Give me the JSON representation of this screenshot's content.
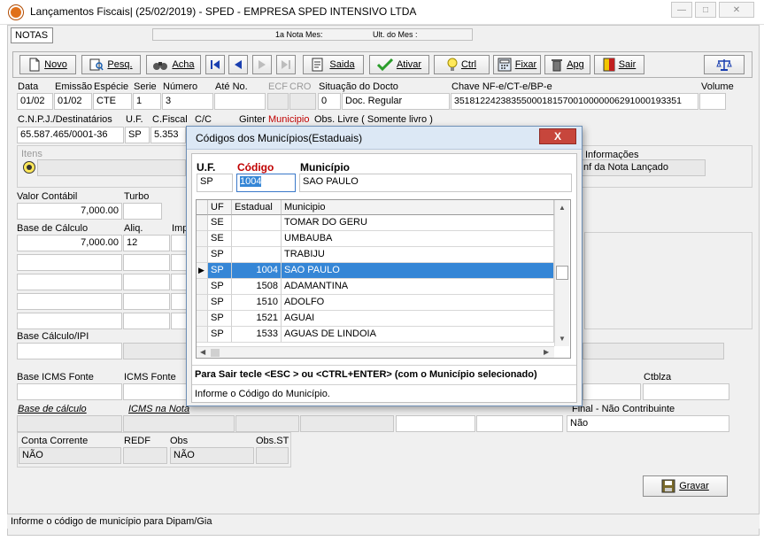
{
  "window": {
    "title": "Lançamentos Fiscais| (25/02/2019) - SPED - EMPRESA SPED INTENSIVO LTDA"
  },
  "header": {
    "tab_label": "NOTAS",
    "nota_mes_label": "1a Nota Mes:",
    "ult_mes_label": "Ult. do Mes :"
  },
  "toolbar": {
    "novo": "Novo",
    "pesq": "Pesq.",
    "acha": "Acha",
    "saida": "Saida",
    "ativar": "Ativar",
    "ctl": "Ctrl",
    "fixar": "Fixar",
    "apg": "Apg",
    "sair": "Sair"
  },
  "doc": {
    "labels": {
      "data": "Data",
      "emissao": "Emissão",
      "especie": "Espécie",
      "serie": "Serie",
      "numero": "Número",
      "ate_no": "Até No.",
      "ecf": "ECF",
      "cro": "CRO",
      "situacao": "Situação do Docto",
      "chave": "Chave NF-e/CT-e/BP-e",
      "volume": "Volume"
    },
    "values": {
      "data": "01/02",
      "emissao": "01/02",
      "especie": "CTE",
      "serie": "1",
      "numero": "3",
      "ate_no": "",
      "situacao_code": "0",
      "situacao_desc": "Doc. Regular",
      "chave": "35181224238355000181570010000006291000193351",
      "volume": ""
    }
  },
  "dest": {
    "labels": {
      "cnpj": "C.N.P.J./Destinatários",
      "uf": "U.F.",
      "cfiscal": "C.Fiscal",
      "cc": "C/C",
      "ginter": "Ginter",
      "municipio": "Municipio",
      "obs_livre": "Obs. Livre ( Somente livro )"
    },
    "values": {
      "cnpj": "65.587.465/0001-36",
      "uf": "SP",
      "cfiscal": "5.353"
    }
  },
  "itens": {
    "label": "Itens",
    "info_label": "Informações",
    "info_value": "nf da Nota Lançado"
  },
  "valores": {
    "labels": {
      "valor_contabil": "Valor Contábil",
      "turbo": "Turbo",
      "base_calculo": "Base de Cálculo",
      "aliq": "Aliq.",
      "imposto": "Imp"
    },
    "valor_contabil": "7,000.00",
    "base_rows": [
      {
        "base": "7,000.00",
        "aliq": "12"
      },
      {
        "base": "",
        "aliq": ""
      },
      {
        "base": "",
        "aliq": ""
      },
      {
        "base": "",
        "aliq": ""
      },
      {
        "base": "",
        "aliq": ""
      }
    ]
  },
  "ipi": {
    "label": "Base Cálculo/IPI"
  },
  "icms_fonte": {
    "base_label": "Base ICMS Fonte",
    "icms_label": "ICMS Fonte",
    "ctblza_label": "Ctblza"
  },
  "outros": {
    "base_calculo_label": "Base de cálculo",
    "icms_nota_label": "ICMS na Nota",
    "nao_contrib_label": "Final - Não Contribuinte",
    "nao_contrib_value": "Não"
  },
  "conta": {
    "labels": {
      "conta_corrente": "Conta Corrente",
      "redf": "REDF",
      "obs": "Obs",
      "obs_st": "Obs.ST"
    },
    "values": {
      "conta_corrente": "NÃO",
      "obs": "NÃO"
    }
  },
  "gravar": "Gravar",
  "status": "Informe o código de município para Dipam/Gia",
  "dialog": {
    "title": "Códigos dos Municípios(Estaduais)",
    "close": "X",
    "labels": {
      "uf": "U.F.",
      "codigo": "Código",
      "municipio": "Município"
    },
    "values": {
      "uf": "SP",
      "codigo": "1004",
      "municipio": "SAO PAULO"
    },
    "columns": [
      "UF",
      "Estadual",
      "Municipio"
    ],
    "rows": [
      {
        "uf": "SE",
        "estadual": "",
        "municipio": "TOMAR DO GERU",
        "selected": false
      },
      {
        "uf": "SE",
        "estadual": "",
        "municipio": "UMBAUBA",
        "selected": false
      },
      {
        "uf": "SP",
        "estadual": "",
        "municipio": "TRABIJU",
        "selected": false
      },
      {
        "uf": "SP",
        "estadual": "1004",
        "municipio": "SAO PAULO",
        "selected": true
      },
      {
        "uf": "SP",
        "estadual": "1508",
        "municipio": "ADAMANTINA",
        "selected": false
      },
      {
        "uf": "SP",
        "estadual": "1510",
        "municipio": "ADOLFO",
        "selected": false
      },
      {
        "uf": "SP",
        "estadual": "1521",
        "municipio": "AGUAI",
        "selected": false
      },
      {
        "uf": "SP",
        "estadual": "1533",
        "municipio": "AGUAS DE LINDOIA",
        "selected": false
      }
    ],
    "hint": "Para Sair tecle <ESC > ou  <CTRL+ENTER> (com o Município selecionado)",
    "footer": "Informe o Código do Município."
  },
  "colors": {
    "selection": "#3586d6",
    "required_label": "#c00000",
    "close_button": "#c7463c"
  }
}
